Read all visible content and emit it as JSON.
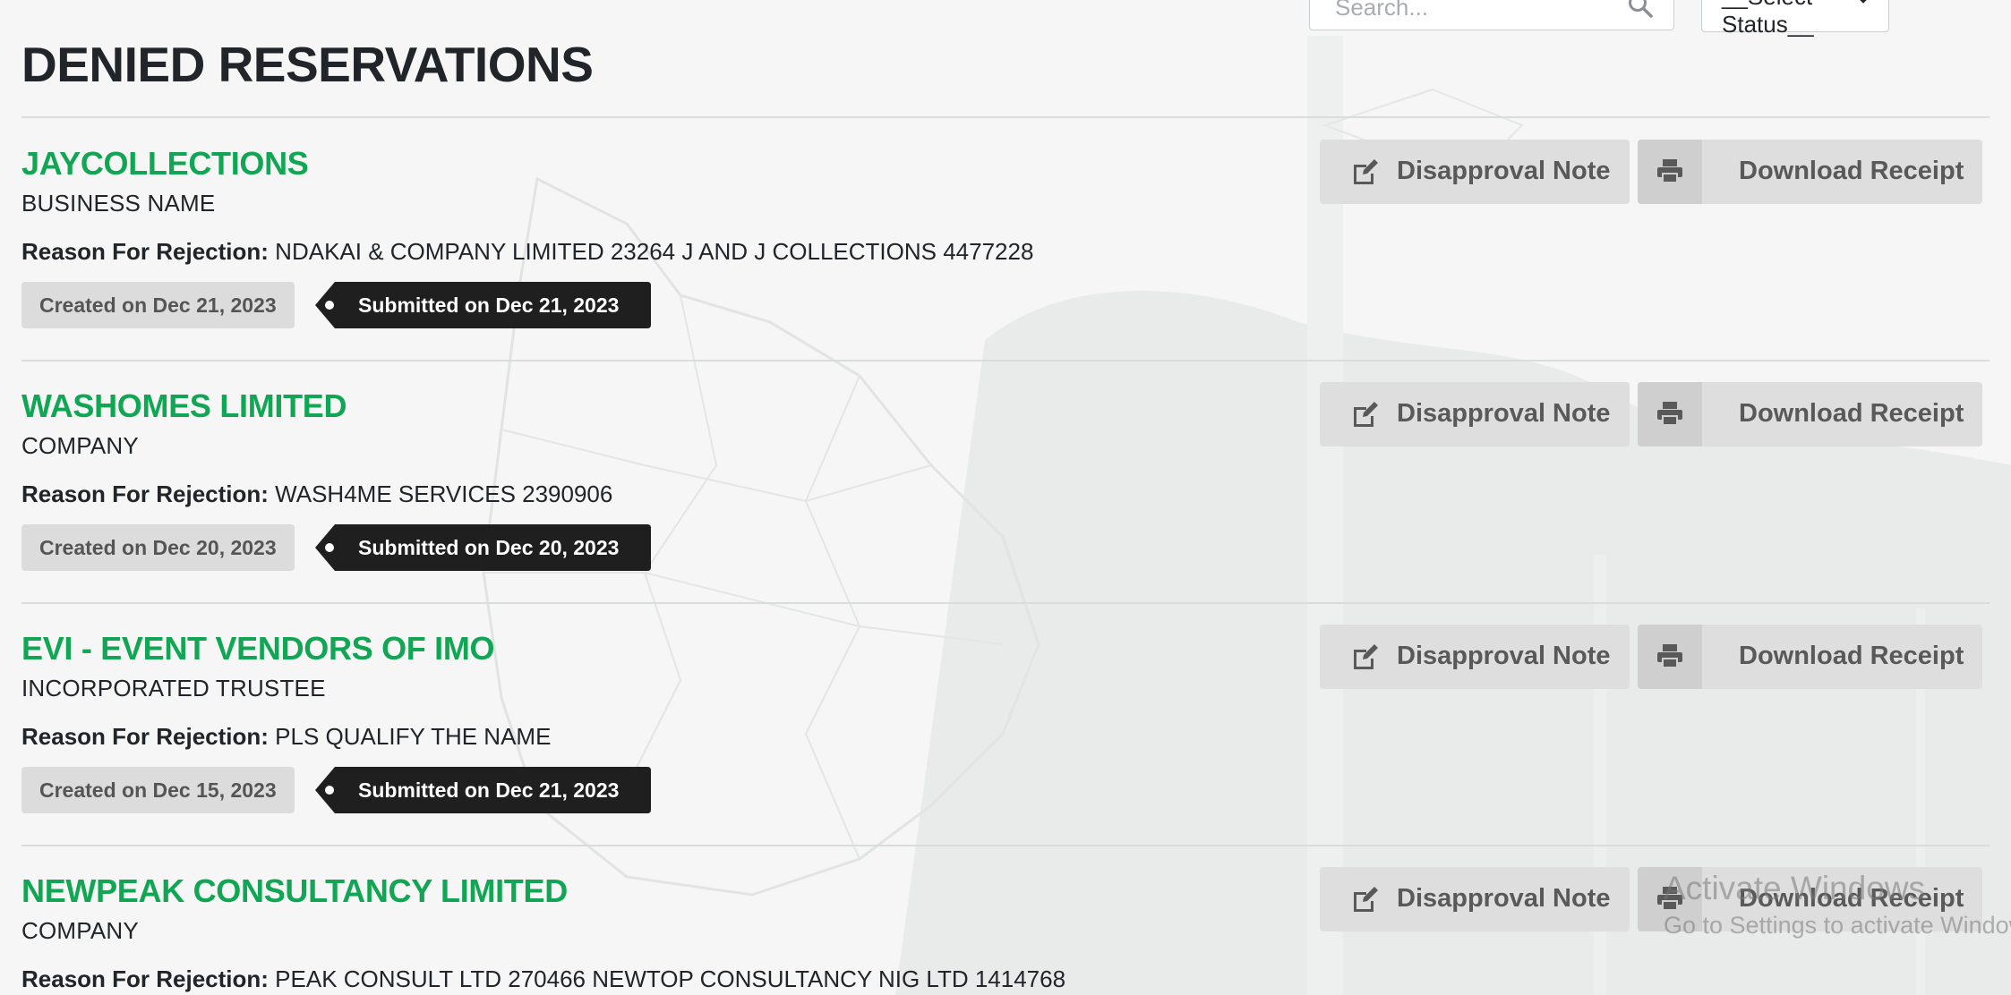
{
  "search": {
    "placeholder": "Search..."
  },
  "status_filter": {
    "selected": "__Select Status__"
  },
  "page_title": "DENIED RESERVATIONS",
  "reservations": [
    {
      "name": "JAYCOLLECTIONS",
      "type": "BUSINESS NAME",
      "reason_label": "Reason For Rejection:",
      "reason": "NDAKAI & COMPANY LIMITED 23264 J AND J COLLECTIONS 4477228",
      "created": "Created on Dec 21, 2023",
      "submitted": "Submitted on Dec 21, 2023",
      "note_label": "Disapproval Note",
      "receipt_label": "Download Receipt"
    },
    {
      "name": "WASHOMES LIMITED",
      "type": "COMPANY",
      "reason_label": "Reason For Rejection:",
      "reason": "WASH4ME SERVICES 2390906",
      "created": "Created on Dec 20, 2023",
      "submitted": "Submitted on Dec 20, 2023",
      "note_label": "Disapproval Note",
      "receipt_label": "Download Receipt"
    },
    {
      "name": "EVI - EVENT VENDORS OF IMO",
      "type": "INCORPORATED TRUSTEE",
      "reason_label": "Reason For Rejection:",
      "reason": "PLS QUALIFY THE NAME",
      "created": "Created on Dec 15, 2023",
      "submitted": "Submitted on Dec 21, 2023",
      "note_label": "Disapproval Note",
      "receipt_label": "Download Receipt"
    },
    {
      "name": "NEWPEAK CONSULTANCY LIMITED",
      "type": "COMPANY",
      "reason_label": "Reason For Rejection:",
      "reason": "PEAK CONSULT LTD 270466 NEWTOP CONSULTANCY NIG LTD 1414768",
      "note_label": "Disapproval Note",
      "receipt_label": "Download Receipt"
    }
  ],
  "watermark": {
    "line1": "Activate Windows",
    "line2": "Go to Settings to activate Windows."
  },
  "colors": {
    "name_green": "#11a653",
    "submitted_bg": "#1f1f1f",
    "created_bg": "#dcdcdc",
    "button_bg": "#dedede"
  }
}
